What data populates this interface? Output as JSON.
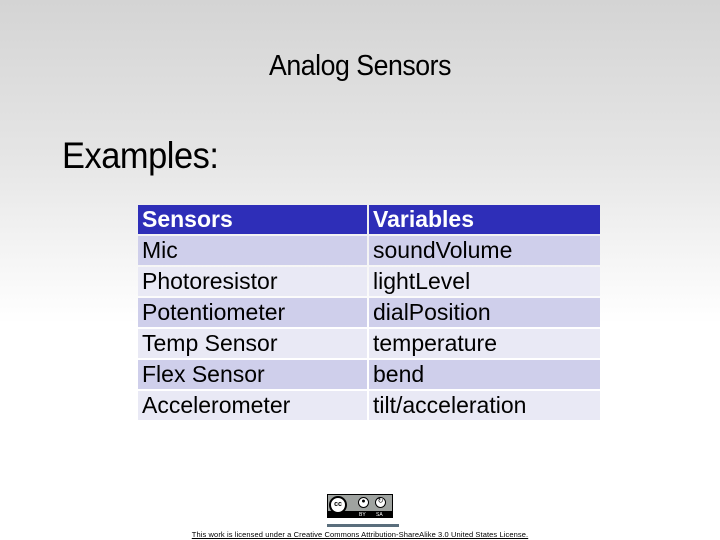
{
  "slide": {
    "title": "Analog Sensors",
    "subtitle": "Examples:"
  },
  "table": {
    "headers": [
      "Sensors",
      "Variables"
    ],
    "rows": [
      [
        "Mic",
        "soundVolume"
      ],
      [
        "Photoresistor",
        "lightLevel"
      ],
      [
        "Potentiometer",
        "dialPosition"
      ],
      [
        "Temp Sensor",
        "temperature"
      ],
      [
        "Flex Sensor",
        "bend"
      ],
      [
        "Accelerometer",
        "tilt/acceleration"
      ]
    ],
    "colors": {
      "header_bg": "#2e2eb8",
      "row_odd_bg": "#cfcfeb",
      "row_even_bg": "#e9e9f5"
    }
  },
  "footer": {
    "badge": {
      "icon": "creative-commons-by-sa-badge",
      "cc_text": "cc",
      "by_label": "BY",
      "sa_label": "SA"
    },
    "license_text": "This work is licensed under a Creative Commons Attribution-ShareAlike 3.0 United States License."
  }
}
